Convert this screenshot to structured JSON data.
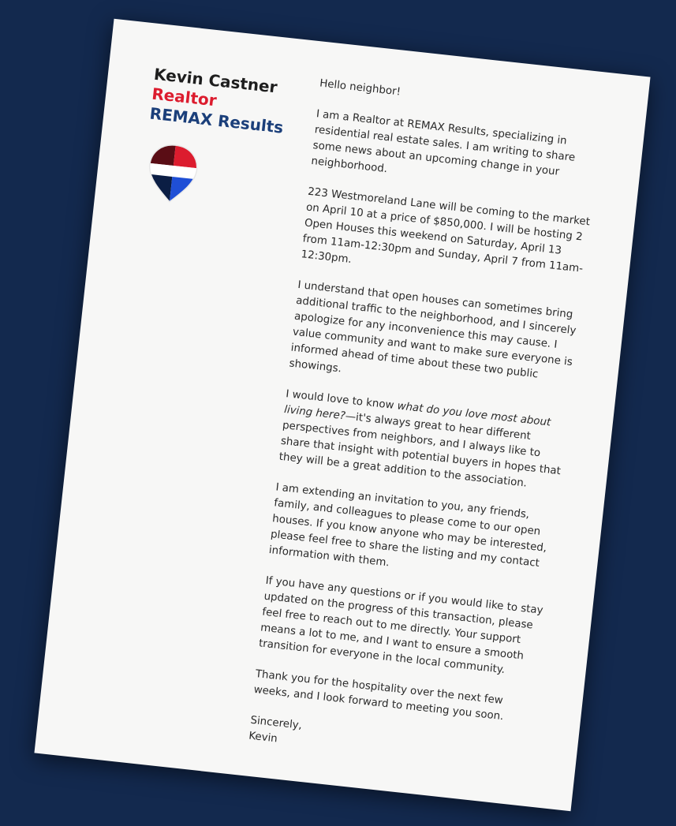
{
  "sender": {
    "name": "Kevin Castner",
    "title": "Realtor",
    "company": "REMAX Results",
    "logo_icon": "hot-air-balloon-logo-icon",
    "colors": {
      "red": "#dc1c2e",
      "blue": "#1b3f7a",
      "dark_red": "#5a0d15",
      "dark_blue": "#0b1e44",
      "navy_background": "#13294e"
    }
  },
  "letter": {
    "greeting": "Hello neighbor!",
    "paragraph_1": "I am a Realtor at REMAX Results, specializing in residential real estate sales. I am writing to share some news about an upcoming change in your neighborhood.",
    "paragraph_2": "223 Westmoreland Lane will be coming to the market on April 10 at a price of $850,000. I will be hosting 2 Open Houses this weekend on Saturday, April 13 from 11am-12:30pm and Sunday, April 7 from 11am-12:30pm.",
    "paragraph_3": "I understand that open houses can sometimes bring additional traffic to the neighborhood, and I sincerely apologize for any inconvenience this may cause. I value community and want to make sure everyone is informed ahead of time about these two public showings.",
    "paragraph_4_lead": "I would love to know ",
    "paragraph_4_question": "what do you love most about living here?",
    "paragraph_4_rest": "—it's always great to hear different perspectives from neighbors, and I always like to share that insight with potential buyers in hopes that they will be a great addition to the association.",
    "paragraph_5": "I am extending an invitation to you, any friends, family, and colleagues to please come to our open houses. If you know anyone who may be interested, please feel free to share the listing and my contact information with them.",
    "paragraph_6": "If you have any questions or if you would like to stay updated on the progress of this transaction, please feel free to reach out to me directly. Your support means a lot to me, and I want to ensure a smooth transition for everyone in the local community.",
    "paragraph_7": "Thank you for the hospitality over the next few weeks, and I look forward to meeting you soon.",
    "closing": "Sincerely,",
    "signature": "Kevin"
  }
}
